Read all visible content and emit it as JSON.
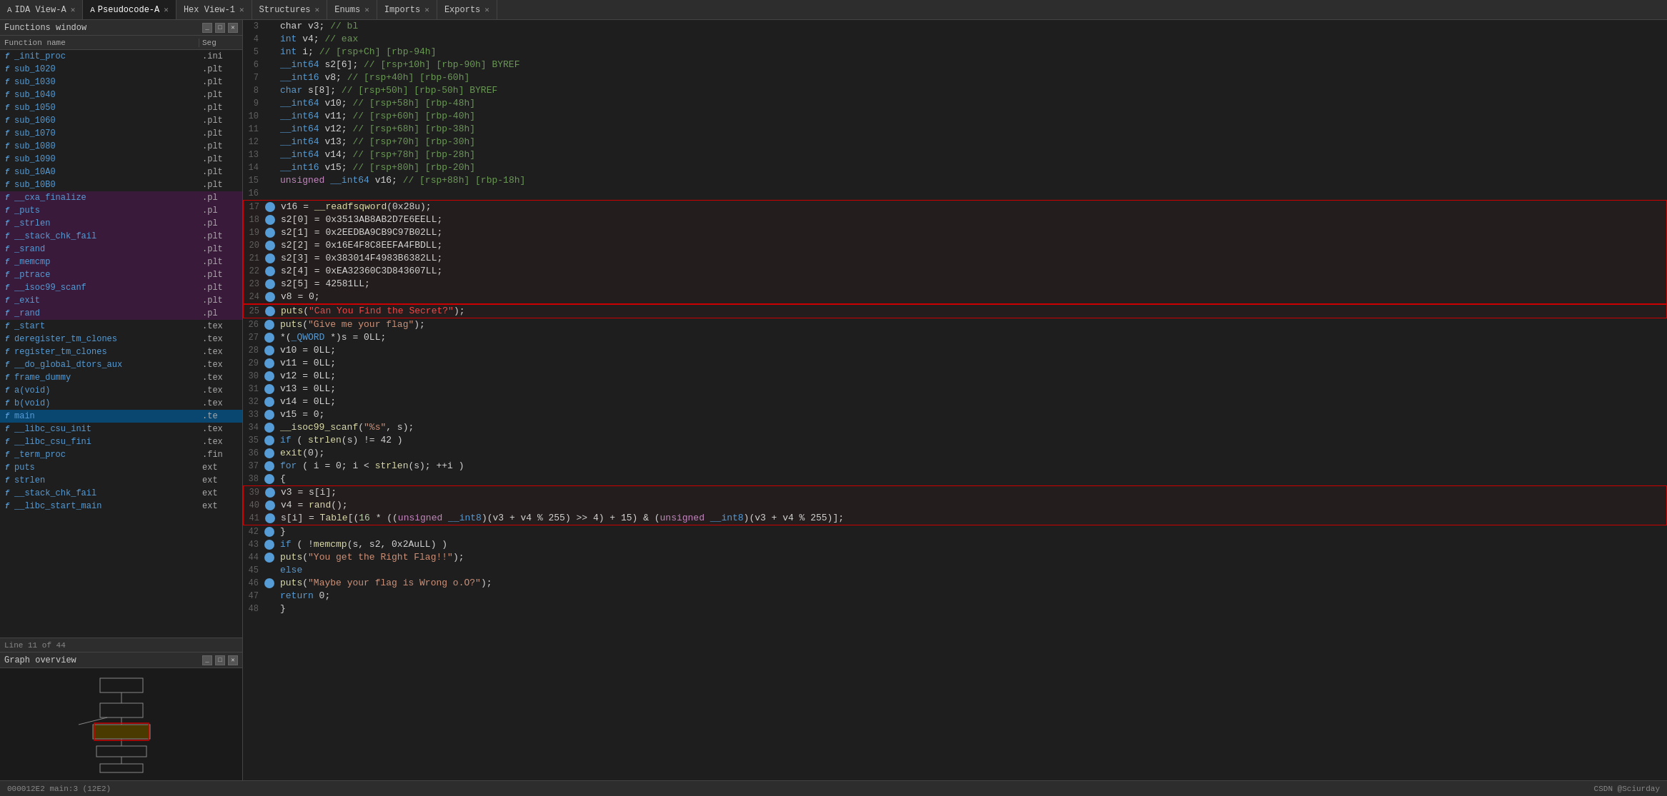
{
  "tabs": [
    {
      "id": "ida-view-a",
      "label": "IDA View-A",
      "active": false,
      "closeable": true
    },
    {
      "id": "pseudocode-a",
      "label": "Pseudocode-A",
      "active": true,
      "closeable": true
    },
    {
      "id": "hex-view-1",
      "label": "Hex View-1",
      "active": false,
      "closeable": true
    },
    {
      "id": "structures",
      "label": "Structures",
      "active": false,
      "closeable": true
    },
    {
      "id": "enums",
      "label": "Enums",
      "active": false,
      "closeable": true
    },
    {
      "id": "imports",
      "label": "Imports",
      "active": false,
      "closeable": true
    },
    {
      "id": "exports",
      "label": "Exports",
      "active": false,
      "closeable": true
    }
  ],
  "functions_panel": {
    "title": "Functions window",
    "col_name": "Function name",
    "col_seg": "Seg",
    "functions": [
      {
        "name": "_init_proc",
        "seg": ".ini",
        "icon": "f",
        "highlight": false
      },
      {
        "name": "sub_1020",
        "seg": ".plt",
        "icon": "f",
        "highlight": false
      },
      {
        "name": "sub_1030",
        "seg": ".plt",
        "icon": "f",
        "highlight": false
      },
      {
        "name": "sub_1040",
        "seg": ".plt",
        "icon": "f",
        "highlight": false
      },
      {
        "name": "sub_1050",
        "seg": ".plt",
        "icon": "f",
        "highlight": false
      },
      {
        "name": "sub_1060",
        "seg": ".plt",
        "icon": "f",
        "highlight": false
      },
      {
        "name": "sub_1070",
        "seg": ".plt",
        "icon": "f",
        "highlight": false
      },
      {
        "name": "sub_1080",
        "seg": ".plt",
        "icon": "f",
        "highlight": false
      },
      {
        "name": "sub_1090",
        "seg": ".plt",
        "icon": "f",
        "highlight": false
      },
      {
        "name": "sub_10A0",
        "seg": ".plt",
        "icon": "f",
        "highlight": false
      },
      {
        "name": "sub_10B0",
        "seg": ".plt",
        "icon": "f",
        "highlight": false
      },
      {
        "name": "__cxa_finalize",
        "seg": ".pl",
        "icon": "f",
        "highlight": true
      },
      {
        "name": "_puts",
        "seg": ".pl",
        "icon": "f",
        "highlight": true
      },
      {
        "name": "_strlen",
        "seg": ".pl",
        "icon": "f",
        "highlight": true
      },
      {
        "name": "__stack_chk_fail",
        "seg": ".plt",
        "icon": "f",
        "highlight": true
      },
      {
        "name": "_srand",
        "seg": ".plt",
        "icon": "f",
        "highlight": true
      },
      {
        "name": "_memcmp",
        "seg": ".plt",
        "icon": "f",
        "highlight": true
      },
      {
        "name": "_ptrace",
        "seg": ".plt",
        "icon": "f",
        "highlight": true
      },
      {
        "name": "__isoc99_scanf",
        "seg": ".plt",
        "icon": "f",
        "highlight": true
      },
      {
        "name": "_exit",
        "seg": ".plt",
        "icon": "f",
        "highlight": true
      },
      {
        "name": "_rand",
        "seg": ".pl",
        "icon": "f",
        "highlight": true
      },
      {
        "name": "_start",
        "seg": ".tex",
        "icon": "f",
        "highlight": false
      },
      {
        "name": "deregister_tm_clones",
        "seg": ".tex",
        "icon": "f",
        "highlight": false
      },
      {
        "name": "register_tm_clones",
        "seg": ".tex",
        "icon": "f",
        "highlight": false
      },
      {
        "name": "__do_global_dtors_aux",
        "seg": ".tex",
        "icon": "f",
        "highlight": false
      },
      {
        "name": "frame_dummy",
        "seg": ".tex",
        "icon": "f",
        "highlight": false
      },
      {
        "name": "a(void)",
        "seg": ".tex",
        "icon": "f",
        "highlight": false
      },
      {
        "name": "b(void)",
        "seg": ".tex",
        "icon": "f",
        "highlight": false
      },
      {
        "name": "main",
        "seg": ".te",
        "icon": "f",
        "highlight": false
      },
      {
        "name": "__libc_csu_init",
        "seg": ".tex",
        "icon": "f",
        "highlight": false
      },
      {
        "name": "__libc_csu_fini",
        "seg": ".tex",
        "icon": "f",
        "highlight": false
      },
      {
        "name": "_term_proc",
        "seg": ".fin",
        "icon": "f",
        "highlight": false
      },
      {
        "name": "puts",
        "seg": "ext",
        "icon": "f",
        "highlight": false
      },
      {
        "name": "strlen",
        "seg": "ext",
        "icon": "f",
        "highlight": false
      },
      {
        "name": "__stack_chk_fail",
        "seg": "ext",
        "icon": "f",
        "highlight": false
      },
      {
        "name": "__libc_start_main",
        "seg": "ext",
        "icon": "f",
        "highlight": false
      }
    ],
    "line_info": "Line 11 of 44"
  },
  "graph_panel": {
    "title": "Graph overview"
  },
  "code": {
    "lines": [
      {
        "num": 3,
        "dot": false,
        "content": "  char v3; <span class='cmt'>// bl</span>"
      },
      {
        "num": 4,
        "dot": false,
        "content": "  <span class='kw'>int</span> v4; <span class='cmt'>// eax</span>"
      },
      {
        "num": 5,
        "dot": false,
        "content": "  <span class='kw'>int</span> i; <span class='cmt'>// [rsp+Ch] [rbp-94h]</span>"
      },
      {
        "num": 6,
        "dot": false,
        "content": "  <span class='kw'>__int64</span> s2[6]; <span class='cmt'>// [rsp+10h] [rbp-90h] BYREF</span>"
      },
      {
        "num": 7,
        "dot": false,
        "content": "  <span class='kw'>__int16</span> v8; <span class='cmt'>// [rsp+40h] [rbp-60h]</span>"
      },
      {
        "num": 8,
        "dot": false,
        "content": "  <span class='kw'>char</span> s[8]; <span class='cmt'>// [rsp+50h] [rbp-50h] BYREF</span>"
      },
      {
        "num": 9,
        "dot": false,
        "content": "  <span class='kw'>__int64</span> v10; <span class='cmt'>// [rsp+58h] [rbp-48h]</span>"
      },
      {
        "num": 10,
        "dot": false,
        "content": "  <span class='kw'>__int64</span> v11; <span class='cmt'>// [rsp+60h] [rbp-40h]</span>"
      },
      {
        "num": 11,
        "dot": false,
        "content": "  <span class='kw'>__int64</span> v12; <span class='cmt'>// [rsp+68h] [rbp-38h]</span>"
      },
      {
        "num": 12,
        "dot": false,
        "content": "  <span class='kw'>__int64</span> v13; <span class='cmt'>// [rsp+70h] [rbp-30h]</span>"
      },
      {
        "num": 13,
        "dot": false,
        "content": "  <span class='kw'>__int64</span> v14; <span class='cmt'>// [rsp+78h] [rbp-28h]</span>"
      },
      {
        "num": 14,
        "dot": false,
        "content": "  <span class='kw'>__int16</span> v15; <span class='cmt'>// [rsp+80h] [rbp-20h]</span>"
      },
      {
        "num": 15,
        "dot": false,
        "content": "  <span class='kw2'>unsigned</span> <span class='kw'>__int64</span> v16; <span class='cmt'>// [rsp+88h] [rbp-18h]</span>"
      },
      {
        "num": 16,
        "dot": false,
        "content": ""
      },
      {
        "num": 17,
        "dot": true,
        "content": "  v16 = <span class='fn'>__readfsqword</span>(0x28u);",
        "box": 1
      },
      {
        "num": 18,
        "dot": true,
        "content": "  s2[0] = 0x3513AB8AB2D7E6EELL;",
        "box": 1
      },
      {
        "num": 19,
        "dot": true,
        "content": "  s2[1] = 0x2EEDBA9CB9C97B02LL;",
        "box": 1
      },
      {
        "num": 20,
        "dot": true,
        "content": "  s2[2] = 0x16E4F8C8EEFA4FBDLL;",
        "box": 1
      },
      {
        "num": 21,
        "dot": true,
        "content": "  s2[3] = 0x383014F4983B6382LL;",
        "box": 1
      },
      {
        "num": 22,
        "dot": true,
        "content": "  s2[4] = 0xEA32360C3D843607LL;",
        "box": 1
      },
      {
        "num": 23,
        "dot": true,
        "content": "  s2[5] = 42581LL;",
        "box": 1
      },
      {
        "num": 24,
        "dot": true,
        "content": "  v8 = 0;",
        "box": 1
      },
      {
        "num": 25,
        "dot": true,
        "content": "  <span class='fn'>puts</span>(<span class='str'>\"Can You Find the Secret?\"</span>);",
        "box": 2
      },
      {
        "num": 26,
        "dot": true,
        "content": "  <span class='fn'>puts</span>(<span class='str'>\"Give me your flag\"</span>);"
      },
      {
        "num": 27,
        "dot": true,
        "content": "  *(<span class='kw'>_QWORD</span> *)s = 0LL;"
      },
      {
        "num": 28,
        "dot": true,
        "content": "  v10 = 0LL;"
      },
      {
        "num": 29,
        "dot": true,
        "content": "  v11 = 0LL;"
      },
      {
        "num": 30,
        "dot": true,
        "content": "  v12 = 0LL;"
      },
      {
        "num": 31,
        "dot": true,
        "content": "  v13 = 0LL;"
      },
      {
        "num": 32,
        "dot": true,
        "content": "  v14 = 0LL;"
      },
      {
        "num": 33,
        "dot": true,
        "content": "  v15 = 0;"
      },
      {
        "num": 34,
        "dot": true,
        "content": "  <span class='fn'>__isoc99_scanf</span>(<span class='str'>\"%s\"</span>, s);"
      },
      {
        "num": 35,
        "dot": true,
        "content": "  <span class='kw'>if</span> ( <span class='fn'>strlen</span>(s) != 42 )"
      },
      {
        "num": 36,
        "dot": true,
        "content": "    <span class='fn'>exit</span>(0);"
      },
      {
        "num": 37,
        "dot": true,
        "content": "  <span class='kw'>for</span> ( i = 0; i &lt; <span class='fn'>strlen</span>(s); ++i )"
      },
      {
        "num": 38,
        "dot": true,
        "content": "  {"
      },
      {
        "num": 39,
        "dot": true,
        "content": "    v3 = s[i];",
        "box": 3
      },
      {
        "num": 40,
        "dot": true,
        "content": "    v4 = <span class='fn'>rand</span>();",
        "box": 3
      },
      {
        "num": 41,
        "dot": true,
        "content": "    s[i] = <span class='fn'>Table</span>[(<span class='num'>16</span> * ((<span class='kw2'>unsigned</span> <span class='kw'>__int8</span>)(v3 + v4 % 255) &gt;&gt; 4) + 15) &amp; (<span class='kw2'>unsigned</span> <span class='kw'>__int8</span>)(v3 + v4 % 255)];",
        "box": 3
      },
      {
        "num": 42,
        "dot": true,
        "content": "  }"
      },
      {
        "num": 43,
        "dot": true,
        "content": "  <span class='kw'>if</span> ( !<span class='fn'>memcmp</span>(s, s2, 0x2AuLL) )"
      },
      {
        "num": 44,
        "dot": true,
        "content": "    <span class='fn'>puts</span>(<span class='str'>\"You get the Right Flag!!\"</span>);"
      },
      {
        "num": 45,
        "dot": false,
        "content": "  <span class='kw'>else</span>"
      },
      {
        "num": 46,
        "dot": true,
        "content": "    <span class='fn'>puts</span>(<span class='str'>\"Maybe your flag is Wrong o.O?\"</span>);"
      },
      {
        "num": 47,
        "dot": false,
        "content": "  <span class='kw'>return</span> 0;"
      },
      {
        "num": 48,
        "dot": false,
        "content": "}"
      }
    ]
  },
  "status_bar": {
    "left": "000012E2 main:3 (12E2)",
    "right": "CSDN @Sciurday"
  }
}
